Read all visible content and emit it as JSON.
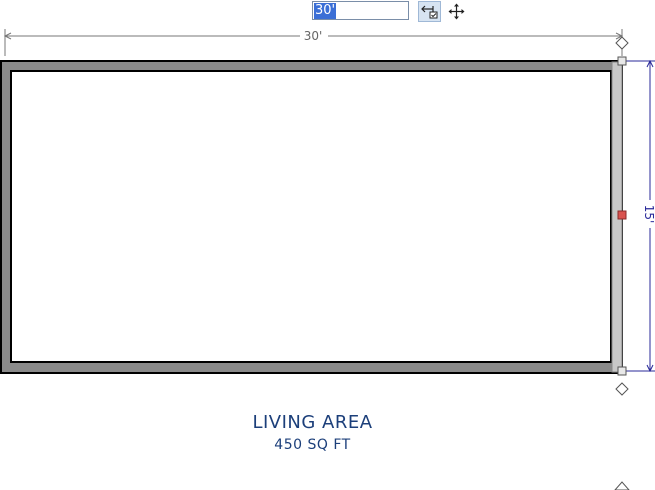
{
  "toolbar": {
    "length_input_value": "30'",
    "length_input_icon": "dimension-edit-icon",
    "move_icon": "move-arrows-icon"
  },
  "dimensions": {
    "width_label": "30'",
    "height_label": "15'"
  },
  "room": {
    "name": "LIVING AREA",
    "area": "450 SQ FT"
  },
  "colors": {
    "wall_fill": "#8a8a8a",
    "wall_outline": "#000000",
    "selected_wall": "#c8c8c8",
    "dimension_line": "#2a2a9a",
    "label_text": "#1c3f7a",
    "center_handle": "#d9534f",
    "input_selection": "#3b6fd6"
  }
}
